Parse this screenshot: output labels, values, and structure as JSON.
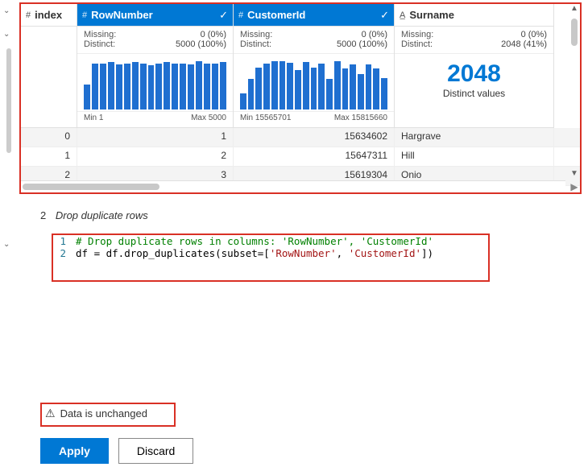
{
  "columns": {
    "index": {
      "name": "index",
      "type_icon": "#"
    },
    "rownum": {
      "name": "RowNumber",
      "type_icon": "#",
      "selected": true,
      "missing_label": "Missing:",
      "missing_val": "0 (0%)",
      "distinct_label": "Distinct:",
      "distinct_val": "5000 (100%)",
      "min_label": "Min 1",
      "max_label": "Max 5000"
    },
    "custid": {
      "name": "CustomerId",
      "type_icon": "#",
      "selected": true,
      "missing_label": "Missing:",
      "missing_val": "0 (0%)",
      "distinct_label": "Distinct:",
      "distinct_val": "5000 (100%)",
      "min_label": "Min 15565701",
      "max_label": "Max 15815660"
    },
    "surname": {
      "name": "Surname",
      "type_icon": "A̲",
      "missing_label": "Missing:",
      "missing_val": "0 (0%)",
      "distinct_label": "Distinct:",
      "distinct_val": "2048 (41%)",
      "big_num": "2048",
      "big_label": "Distinct values"
    }
  },
  "chart_data": [
    {
      "type": "bar",
      "column": "RowNumber",
      "values": [
        50,
        92,
        92,
        94,
        90,
        92,
        95,
        92,
        88,
        92,
        95,
        92,
        92,
        90,
        96,
        92,
        92,
        94
      ],
      "title": "",
      "xlabel": "",
      "ylabel": "",
      "ylim": [
        0,
        100
      ],
      "xmin": "Min 1",
      "xmax": "Max 5000"
    },
    {
      "type": "bar",
      "column": "CustomerId",
      "values": [
        32,
        60,
        82,
        90,
        95,
        95,
        92,
        78,
        94,
        82,
        90,
        60,
        95,
        80,
        88,
        70,
        88,
        80,
        62
      ],
      "title": "",
      "xlabel": "",
      "ylabel": "",
      "ylim": [
        0,
        100
      ],
      "xmin": "Min 15565701",
      "xmax": "Max 15815660"
    }
  ],
  "rows": [
    {
      "index": "0",
      "rownum": "1",
      "custid": "15634602",
      "surname": "Hargrave"
    },
    {
      "index": "1",
      "rownum": "2",
      "custid": "15647311",
      "surname": "Hill"
    },
    {
      "index": "2",
      "rownum": "3",
      "custid": "15619304",
      "surname": "Onio"
    }
  ],
  "step": {
    "number": "2",
    "title": "Drop duplicate rows"
  },
  "code": {
    "line1_num": "1",
    "line1_text": "# Drop duplicate rows in columns: 'RowNumber', 'CustomerId'",
    "line2_num": "2",
    "line2_a": "df = df.drop_duplicates(subset=[",
    "line2_s1": "'RowNumber'",
    "line2_b": ", ",
    "line2_s2": "'CustomerId'",
    "line2_c": "])"
  },
  "status": {
    "icon": "⚠",
    "text": "Data is unchanged"
  },
  "buttons": {
    "apply": "Apply",
    "discard": "Discard"
  }
}
